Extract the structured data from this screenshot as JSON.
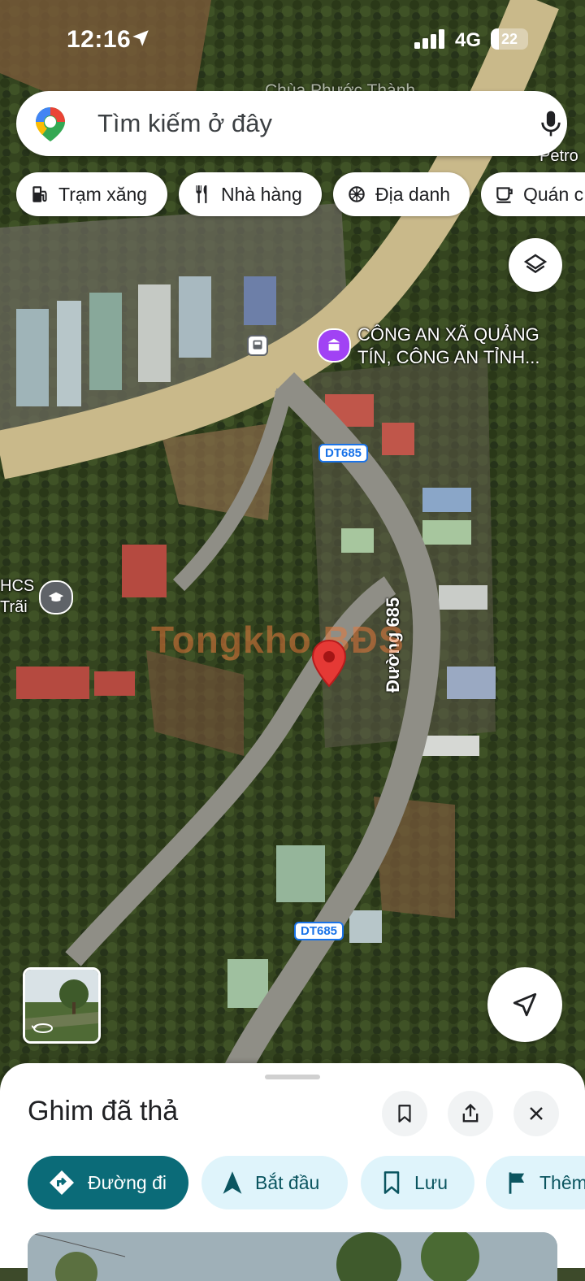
{
  "status_bar": {
    "time": "12:16",
    "network": "4G",
    "battery": "22",
    "battery_level_percent": 22
  },
  "search": {
    "placeholder": "Tìm kiếm ở đây",
    "logo_icon": "google-maps-pin-icon",
    "mic_icon": "microphone-icon"
  },
  "chips": [
    {
      "label": "Trạm xăng",
      "icon": "gas-station-icon"
    },
    {
      "label": "Nhà hàng",
      "icon": "restaurant-icon"
    },
    {
      "label": "Địa danh",
      "icon": "landmark-icon"
    },
    {
      "label": "Quán c",
      "icon": "coffee-icon"
    }
  ],
  "map": {
    "poi_police": "CÔNG AN XÃ QUẢNG TÍN, CÔNG AN TỈNH...",
    "poi_school": "HCS Trãi",
    "road_shield_1": "DT685",
    "road_shield_2": "DT685",
    "road_name": "Đường 685",
    "watermark": "Tongkho BĐS",
    "partial_label_top": "Chùa Phước Thành",
    "partial_label_right": "ra Petro"
  },
  "sheet": {
    "title": "Ghim đã thả",
    "actions": [
      {
        "label": "Đường đi",
        "icon": "directions-icon"
      },
      {
        "label": "Bắt đầu",
        "icon": "navigation-arrow-icon"
      },
      {
        "label": "Lưu",
        "icon": "bookmark-icon"
      },
      {
        "label": "Thêm",
        "icon": "flag-icon"
      }
    ]
  },
  "colors": {
    "primary_action": "#0b6b78",
    "secondary_action_bg": "#dff4fb",
    "pin_red": "#e53935"
  }
}
